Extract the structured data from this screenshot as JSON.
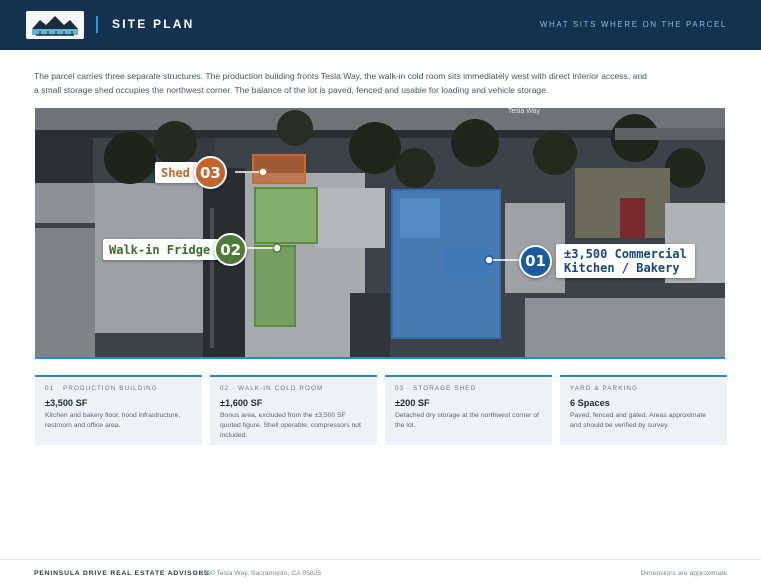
{
  "header": {
    "title": "SITE PLAN",
    "tagline": "WHAT SITS WHERE ON THE PARCEL"
  },
  "intro": "The parcel carries three separate structures. The production building fronts Tesla Way, the walk-in cold room sits immediately west with direct interior access, and a small storage shed occupies the northwest corner. The balance of the lot is paved, fenced and usable for loading and vehicle storage.",
  "map": {
    "street_label": "Tesla Way",
    "callouts": [
      {
        "num": "01",
        "label_line1": "±3,500 Commercial",
        "label_line2": "Kitchen / Bakery",
        "color": "#1a5aa0"
      },
      {
        "num": "02",
        "label": "Walk-in Fridge",
        "color": "#4f7a3a"
      },
      {
        "num": "03",
        "label": "Shed",
        "color": "#c4652e"
      }
    ]
  },
  "cards": [
    {
      "kicker": "01 · PRODUCTION BUILDING",
      "value": "±3,500 SF",
      "desc": "Kitchen and bakery floor, hood infrastructure, restroom and office area."
    },
    {
      "kicker": "02 · WALK-IN COLD ROOM",
      "value": "±1,600 SF",
      "desc": "Bonus area, excluded from the ±3,500 SF quoted figure. Shell operable; compressors not included."
    },
    {
      "kicker": "03 · STORAGE SHED",
      "value": "±200 SF",
      "desc": "Detached dry storage at the northwest corner of the lot."
    },
    {
      "kicker": "YARD & PARKING",
      "value": "6 Spaces",
      "desc": "Paved, fenced and gated. Areas approximate and should be verified by survey."
    }
  ],
  "footer": {
    "firm": "PENINSULA DRIVE REAL ESTATE ADVISORS",
    "address": "–  2530 Tesla Way, Sacramento, CA 95825",
    "note": "Dimensions are approximate"
  },
  "colors": {
    "header_bg": "#13324f",
    "accent": "#2f87c4",
    "kitchen": "#1a5aa0",
    "fridge": "#4f7a3a",
    "shed": "#c4652e"
  }
}
